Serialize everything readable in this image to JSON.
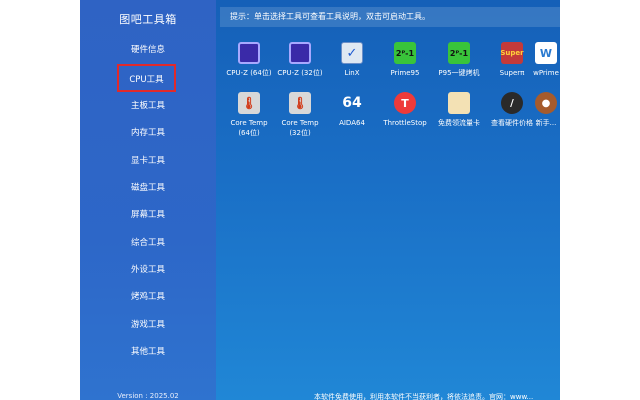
{
  "app": {
    "title": "图吧工具箱",
    "version": "Version : 2025.02"
  },
  "sidebar": {
    "items": [
      {
        "label": "硬件信息"
      },
      {
        "label": "CPU工具",
        "active": true
      },
      {
        "label": "主板工具"
      },
      {
        "label": "内存工具"
      },
      {
        "label": "显卡工具"
      },
      {
        "label": "磁盘工具"
      },
      {
        "label": "屏幕工具"
      },
      {
        "label": "综合工具"
      },
      {
        "label": "外设工具"
      },
      {
        "label": "烤鸡工具"
      },
      {
        "label": "游戏工具"
      },
      {
        "label": "其他工具"
      }
    ]
  },
  "main": {
    "hint": "提示：单击选择工具可查看工具说明，双击可启动工具。",
    "tools": [
      {
        "label": "CPU-Z (64位)",
        "icon": "cpu-z-icon",
        "glyph": ""
      },
      {
        "label": "CPU-Z (32位)",
        "icon": "cpu-z-icon",
        "glyph": ""
      },
      {
        "label": "LinX",
        "icon": "linx-icon",
        "glyph": "✓"
      },
      {
        "label": "Prime95",
        "icon": "prime95-icon",
        "glyph": "2ᴾ-1"
      },
      {
        "label": "P95一键烤机",
        "icon": "prime95-icon",
        "glyph": "2ᴾ-1"
      },
      {
        "label": "Superπ",
        "icon": "superpi-icon",
        "glyph": "Super"
      },
      {
        "label": "wPrime",
        "icon": "wprime-icon",
        "glyph": "W"
      },
      {
        "label": "Core Temp (64位)",
        "line1": "Core Temp",
        "line2": "(64位)",
        "icon": "core-temp-icon",
        "glyph": "🌡"
      },
      {
        "label": "Core Temp (32位)",
        "line1": "Core Temp",
        "line2": "(32位)",
        "icon": "core-temp-icon",
        "glyph": "🌡"
      },
      {
        "label": "AIDA64",
        "icon": "aida64-icon",
        "glyph": "64"
      },
      {
        "label": "ThrottleStop",
        "icon": "throttlestop-icon",
        "glyph": "T"
      },
      {
        "label": "免费领流量卡",
        "icon": "sim-card-icon",
        "glyph": ""
      },
      {
        "label": "查看硬件价格",
        "icon": "price-icon",
        "glyph": "/"
      },
      {
        "label": "新手...",
        "icon": "newbie-icon",
        "glyph": "●"
      }
    ]
  },
  "footer": {
    "text": "本软件免费使用，利用本软件不当获利者，将依法追责。官网：www..."
  }
}
